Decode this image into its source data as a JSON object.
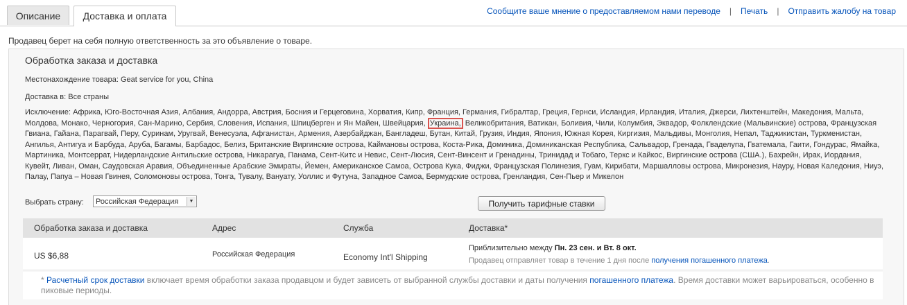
{
  "tabs": {
    "description": "Описание",
    "shipping": "Доставка и оплата"
  },
  "top_links": {
    "feedback": "Сообщите ваше мнение о предоставляемом нами переводе",
    "print": "Печать",
    "report": "Отправить жалобу на товар",
    "separator": "|"
  },
  "seller_note": "Продавец берет на себя полную ответственность за это объявление о товаре.",
  "shipping": {
    "title": "Обработка заказа и доставка",
    "location": "Местонахождение товара: Geat service for you, China",
    "ships_to": "Доставка в: Все страны",
    "exclusions_before": "Исключение: Африка, Юго-Восточная Азия, Албания, Андорра, Австрия, Босния и Герцеговина, Хорватия, Кипр, Франция, Германия, Гибралтар, Греция, Гернси, Исландия, Ирландия, Италия, Джерси, Лихтенштейн, Македония, Мальта, Молдова, Монако, Черногория, Сан-Марино, Сербия, Словения, Испания, Шпицберген и Ян Майен, Швейцария,",
    "exclusions_highlight": "Украина,",
    "exclusions_after": "Великобритания, Ватикан, Боливия, Чили, Колумбия, Эквадор, Фолклендские (Мальвинские) острова, Французская Гвиана, Гайана, Парагвай, Перу, Суринам, Уругвай, Венесуэла, Афганистан, Армения, Азербайджан, Бангладеш, Бутан, Китай, Грузия, Индия, Япония, Южная Корея, Киргизия, Мальдивы, Монголия, Непал, Таджикистан, Туркменистан, Ангилья, Антигуа и Барбуда, Аруба, Багамы, Барбадос, Белиз, Британские Виргинские острова, Каймановы острова, Коста-Рика, Доминика, Доминиканская Республика, Сальвадор, Гренада, Гваделупа, Гватемала, Гаити, Гондурас, Ямайка, Мартиника, Монтсеррат, Нидерландские Антильские острова, Никарагуа, Панама, Сент-Китс и Невис, Сент-Люсия, Сент-Винсент и Гренадины, Тринидад и Тобаго, Теркс и Кайкос, Виргинские острова (США.), Бахрейн, Ирак, Иордания, Кувейт, Ливан, Оман, Саудовская Аравия, Объединенные Арабские Эмираты, Йемен, Американское Самоа, Острова Кука, Фиджи, Французская Полинезия, Гуам, Кирибати, Маршалловы острова, Микронезия, Науру, Новая Каледония, Ниуэ, Палау, Папуа – Новая Гвинея, Соломоновы острова, Тонга, Тувалу, Вануату, Уоллис и Футуна, Западное Самоа, Бермудские острова, Гренландия, Сен-Пьер и Микелон",
    "select_label": "Выбрать страну:",
    "select_value": "Российская Федерация",
    "rates_button": "Получить тарифные ставки"
  },
  "table": {
    "headers": [
      "Обработка заказа и доставка",
      "Адрес",
      "Служба",
      "Доставка*"
    ],
    "row": {
      "price": "US $6,88",
      "address": "Российская Федерация",
      "service": "Economy Int'l Shipping",
      "delivery_prefix": "Приблизительно между",
      "delivery_dates": "Пн. 23 сен. и Вт. 8 окт.",
      "dispatch_text": "Продавец отправляет товар в течение 1 дня после",
      "dispatch_link": "получения погашенного платежа",
      "dispatch_end": "."
    }
  },
  "footnote": {
    "star": "*",
    "link1": "Расчетный срок доставки",
    "text1": "включает время обработки заказа продавцом и будет зависеть от выбранной службы доставки и даты получения",
    "link2": "погашенного платежа",
    "text2": ". Время доставки может варьироваться, особенно в пиковые периоды."
  }
}
